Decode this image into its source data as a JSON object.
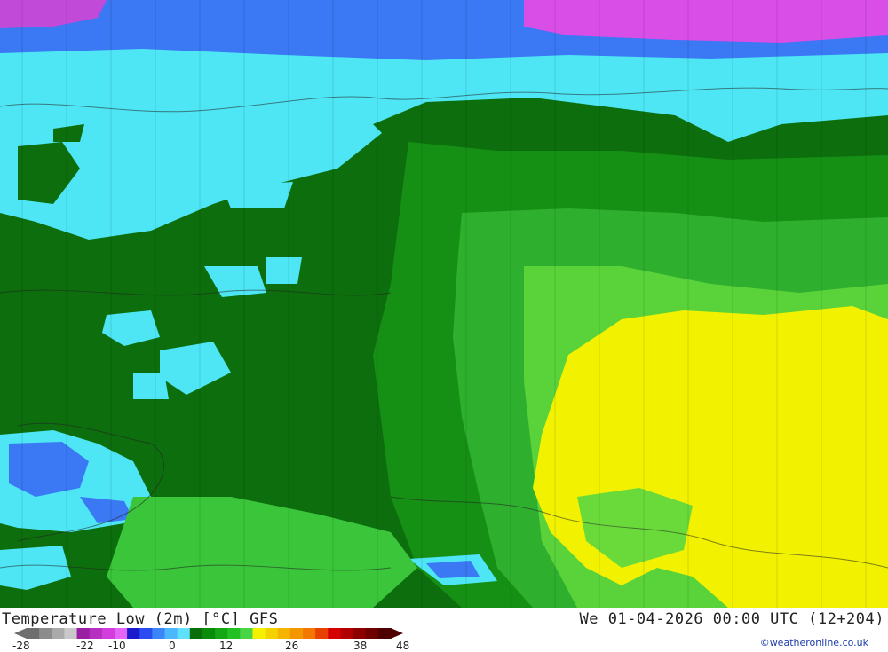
{
  "map": {
    "title": "Temperature Low (2m) [°C] GFS",
    "datetime": "We 01-04-2026 00:00 UTC (12+204)",
    "credit": "©weatheronline.co.uk"
  },
  "legend": {
    "ticks": [
      "-28",
      "-22",
      "-10",
      "0",
      "12",
      "26",
      "38",
      "48"
    ],
    "colors": [
      "#6e6e6e",
      "#8c8c8c",
      "#aaaaaa",
      "#c8c8c8",
      "#9b1fa3",
      "#b62fc0",
      "#d23ede",
      "#e664f5",
      "#1a1acc",
      "#2a4cf0",
      "#3a86f8",
      "#4cb8fb",
      "#5ee0fe",
      "#0a6e0a",
      "#0a8c0a",
      "#14a614",
      "#22c022",
      "#48d648",
      "#f4f000",
      "#f4d200",
      "#f4b400",
      "#f49600",
      "#f47800",
      "#e84000",
      "#d60000",
      "#b00000",
      "#8c0000",
      "#6e0000",
      "#4e0000"
    ]
  },
  "colors": {
    "dark_green": "#0d6e0d",
    "mid_green": "#159015",
    "bright_green": "#3ac53a",
    "light_green": "#78e240",
    "cyan": "#4ee6f4",
    "blue": "#3a78f4",
    "magenta": "#d84ee6",
    "yellow": "#f2f200"
  }
}
